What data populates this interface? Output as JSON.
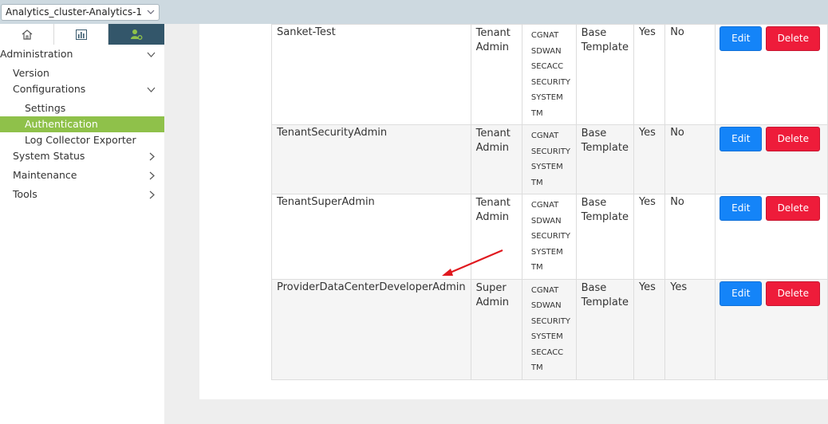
{
  "topbar": {
    "cluster_selector": "Analytics_cluster-Analytics-1"
  },
  "sidebar": {
    "tabs": [
      {
        "icon": "home-icon"
      },
      {
        "icon": "bar-chart-icon"
      },
      {
        "icon": "user-settings-icon",
        "active": true
      }
    ],
    "items": [
      {
        "label": "Administration",
        "expanded": true
      },
      {
        "label": "Version"
      },
      {
        "label": "Configurations",
        "expanded": true
      },
      {
        "label": "Settings"
      },
      {
        "label": "Authentication",
        "active": true
      },
      {
        "label": "Log Collector Exporter"
      },
      {
        "label": "System Status"
      },
      {
        "label": "Maintenance"
      },
      {
        "label": "Tools"
      }
    ]
  },
  "table": {
    "rows": [
      {
        "name": "Sanket-Test",
        "role_line1": "Tenant",
        "role_line2": "Admin",
        "services": [
          "CGNAT",
          "SDWAN",
          "SECACC",
          "SECURITY",
          "SYSTEM",
          "TM"
        ],
        "template_line1": "Base",
        "template_line2": "Template",
        "default": "Yes",
        "system": "No",
        "edit_label": "Edit",
        "delete_label": "Delete"
      },
      {
        "name": "TenantSecurityAdmin",
        "role_line1": "Tenant",
        "role_line2": "Admin",
        "services": [
          "CGNAT",
          "SECURITY",
          "SYSTEM",
          "TM"
        ],
        "template_line1": "Base",
        "template_line2": "Template",
        "default": "Yes",
        "system": "No",
        "edit_label": "Edit",
        "delete_label": "Delete"
      },
      {
        "name": "TenantSuperAdmin",
        "role_line1": "Tenant",
        "role_line2": "Admin",
        "services": [
          "CGNAT",
          "SDWAN",
          "SECURITY",
          "SYSTEM",
          "TM"
        ],
        "template_line1": "Base",
        "template_line2": "Template",
        "default": "Yes",
        "system": "No",
        "edit_label": "Edit",
        "delete_label": "Delete"
      },
      {
        "name": "ProviderDataCenterDeveloperAdmin",
        "role_line1": "Super",
        "role_line2": "Admin",
        "services": [
          "CGNAT",
          "SDWAN",
          "SECURITY",
          "SYSTEM",
          "SECACC",
          "TM"
        ],
        "template_line1": "Base",
        "template_line2": "Template",
        "default": "Yes",
        "system": "Yes",
        "edit_label": "Edit",
        "delete_label": "Delete"
      }
    ]
  },
  "colors": {
    "topbar": "#cdd9e0",
    "active_tab": "#33566a",
    "active_item": "#8fc14a",
    "edit_button": "#1484f8",
    "delete_button": "#ee1c3a",
    "annotation_arrow": "#e0191f"
  }
}
